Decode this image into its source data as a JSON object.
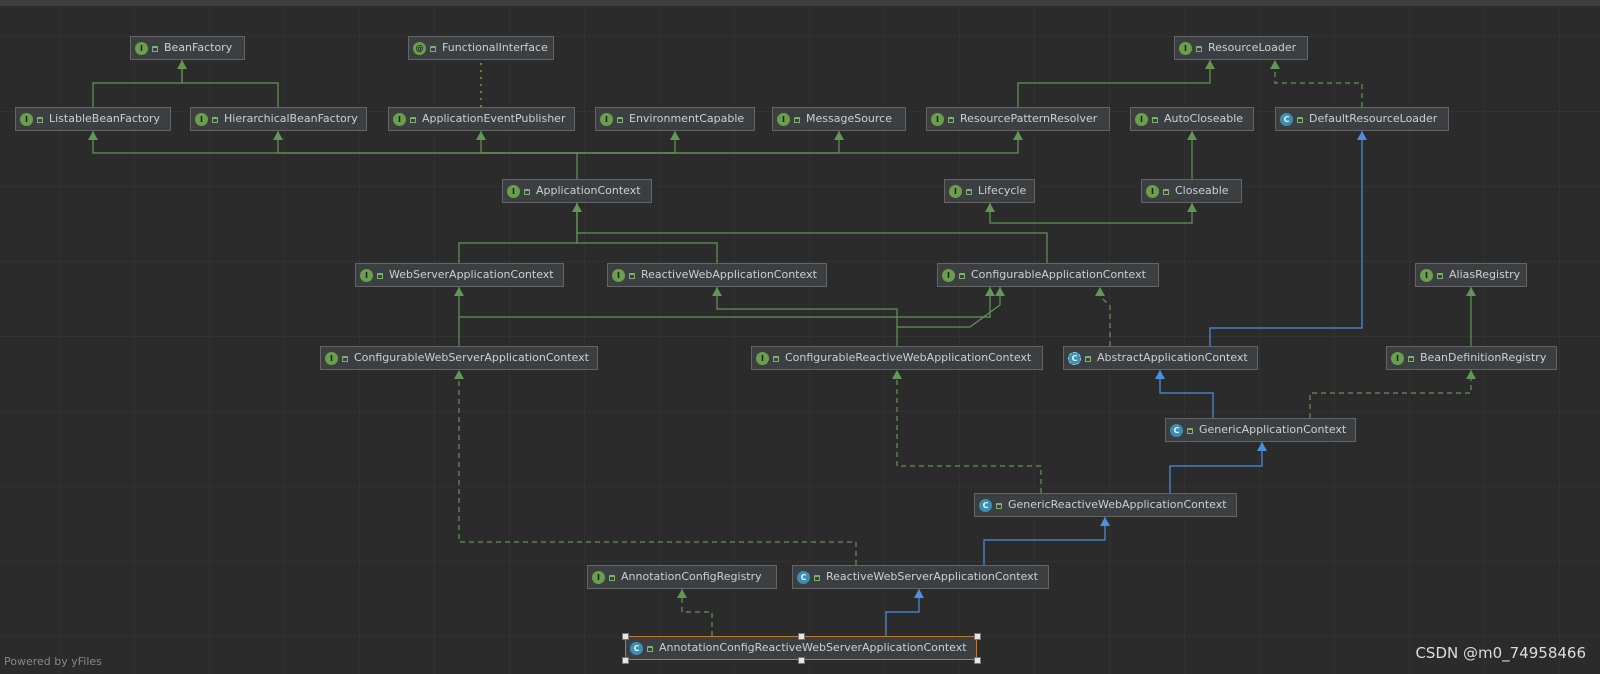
{
  "window": {
    "title": ""
  },
  "nodes": [
    {
      "id": "BeanFactory",
      "label": "BeanFactory",
      "kind": "interface"
    },
    {
      "id": "FunctionalInterface",
      "label": "FunctionalInterface",
      "kind": "annotation"
    },
    {
      "id": "ResourceLoader",
      "label": "ResourceLoader",
      "kind": "interface"
    },
    {
      "id": "ListableBeanFactory",
      "label": "ListableBeanFactory",
      "kind": "interface"
    },
    {
      "id": "HierarchicalBeanFactory",
      "label": "HierarchicalBeanFactory",
      "kind": "interface"
    },
    {
      "id": "ApplicationEventPublisher",
      "label": "ApplicationEventPublisher",
      "kind": "interface"
    },
    {
      "id": "EnvironmentCapable",
      "label": "EnvironmentCapable",
      "kind": "interface"
    },
    {
      "id": "MessageSource",
      "label": "MessageSource",
      "kind": "interface"
    },
    {
      "id": "ResourcePatternResolver",
      "label": "ResourcePatternResolver",
      "kind": "interface"
    },
    {
      "id": "AutoCloseable",
      "label": "AutoCloseable",
      "kind": "interface"
    },
    {
      "id": "DefaultResourceLoader",
      "label": "DefaultResourceLoader",
      "kind": "class"
    },
    {
      "id": "ApplicationContext",
      "label": "ApplicationContext",
      "kind": "interface"
    },
    {
      "id": "Lifecycle",
      "label": "Lifecycle",
      "kind": "interface"
    },
    {
      "id": "Closeable",
      "label": "Closeable",
      "kind": "interface"
    },
    {
      "id": "WebServerApplicationContext",
      "label": "WebServerApplicationContext",
      "kind": "interface"
    },
    {
      "id": "ReactiveWebApplicationContext",
      "label": "ReactiveWebApplicationContext",
      "kind": "interface"
    },
    {
      "id": "ConfigurableApplicationContext",
      "label": "ConfigurableApplicationContext",
      "kind": "interface"
    },
    {
      "id": "AliasRegistry",
      "label": "AliasRegistry",
      "kind": "interface"
    },
    {
      "id": "ConfigurableWebServerApplicationContext",
      "label": "ConfigurableWebServerApplicationContext",
      "kind": "interface"
    },
    {
      "id": "ConfigurableReactiveWebApplicationContext",
      "label": "ConfigurableReactiveWebApplicationContext",
      "kind": "interface"
    },
    {
      "id": "AbstractApplicationContext",
      "label": "AbstractApplicationContext",
      "kind": "abstract"
    },
    {
      "id": "BeanDefinitionRegistry",
      "label": "BeanDefinitionRegistry",
      "kind": "interface"
    },
    {
      "id": "GenericApplicationContext",
      "label": "GenericApplicationContext",
      "kind": "class"
    },
    {
      "id": "GenericReactiveWebApplicationContext",
      "label": "GenericReactiveWebApplicationContext",
      "kind": "class"
    },
    {
      "id": "AnnotationConfigRegistry",
      "label": "AnnotationConfigRegistry",
      "kind": "interface"
    },
    {
      "id": "ReactiveWebServerApplicationContext",
      "label": "ReactiveWebServerApplicationContext",
      "kind": "class"
    },
    {
      "id": "AnnotationConfigReactiveWebServerApplicationContext",
      "label": "AnnotationConfigReactiveWebServerApplicationContext",
      "kind": "class",
      "selected": true
    }
  ],
  "edges": [
    {
      "from": "ListableBeanFactory",
      "to": "BeanFactory",
      "type": "extends"
    },
    {
      "from": "HierarchicalBeanFactory",
      "to": "BeanFactory",
      "type": "extends"
    },
    {
      "from": "ApplicationEventPublisher",
      "to": "FunctionalInterface",
      "type": "annotated"
    },
    {
      "from": "ResourcePatternResolver",
      "to": "ResourceLoader",
      "type": "extends"
    },
    {
      "from": "DefaultResourceLoader",
      "to": "ResourceLoader",
      "type": "implements"
    },
    {
      "from": "ApplicationContext",
      "to": "ListableBeanFactory",
      "type": "extends"
    },
    {
      "from": "ApplicationContext",
      "to": "HierarchicalBeanFactory",
      "type": "extends"
    },
    {
      "from": "ApplicationContext",
      "to": "ApplicationEventPublisher",
      "type": "extends"
    },
    {
      "from": "ApplicationContext",
      "to": "EnvironmentCapable",
      "type": "extends"
    },
    {
      "from": "ApplicationContext",
      "to": "MessageSource",
      "type": "extends"
    },
    {
      "from": "ApplicationContext",
      "to": "ResourcePatternResolver",
      "type": "extends"
    },
    {
      "from": "Closeable",
      "to": "AutoCloseable",
      "type": "extends"
    },
    {
      "from": "WebServerApplicationContext",
      "to": "ApplicationContext",
      "type": "extends"
    },
    {
      "from": "ReactiveWebApplicationContext",
      "to": "ApplicationContext",
      "type": "extends"
    },
    {
      "from": "ConfigurableApplicationContext",
      "to": "ApplicationContext",
      "type": "extends"
    },
    {
      "from": "ConfigurableApplicationContext",
      "to": "Lifecycle",
      "type": "extends"
    },
    {
      "from": "ConfigurableApplicationContext",
      "to": "Closeable",
      "type": "extends"
    },
    {
      "from": "ConfigurableWebServerApplicationContext",
      "to": "WebServerApplicationContext",
      "type": "extends"
    },
    {
      "from": "ConfigurableWebServerApplicationContext",
      "to": "ConfigurableApplicationContext",
      "type": "extends"
    },
    {
      "from": "ConfigurableReactiveWebApplicationContext",
      "to": "ReactiveWebApplicationContext",
      "type": "extends"
    },
    {
      "from": "ConfigurableReactiveWebApplicationContext",
      "to": "ConfigurableApplicationContext",
      "type": "extends"
    },
    {
      "from": "AbstractApplicationContext",
      "to": "ConfigurableApplicationContext",
      "type": "implements"
    },
    {
      "from": "AbstractApplicationContext",
      "to": "DefaultResourceLoader",
      "type": "extends-class"
    },
    {
      "from": "BeanDefinitionRegistry",
      "to": "AliasRegistry",
      "type": "extends"
    },
    {
      "from": "GenericApplicationContext",
      "to": "AbstractApplicationContext",
      "type": "extends-class"
    },
    {
      "from": "GenericApplicationContext",
      "to": "BeanDefinitionRegistry",
      "type": "implements"
    },
    {
      "from": "GenericReactiveWebApplicationContext",
      "to": "GenericApplicationContext",
      "type": "extends-class"
    },
    {
      "from": "GenericReactiveWebApplicationContext",
      "to": "ConfigurableReactiveWebApplicationContext",
      "type": "implements"
    },
    {
      "from": "ReactiveWebServerApplicationContext",
      "to": "GenericReactiveWebApplicationContext",
      "type": "extends-class"
    },
    {
      "from": "ReactiveWebServerApplicationContext",
      "to": "ConfigurableWebServerApplicationContext",
      "type": "implements"
    },
    {
      "from": "AnnotationConfigReactiveWebServerApplicationContext",
      "to": "ReactiveWebServerApplicationContext",
      "type": "extends-class"
    },
    {
      "from": "AnnotationConfigReactiveWebServerApplicationContext",
      "to": "AnnotationConfigRegistry",
      "type": "implements"
    }
  ],
  "colors": {
    "interface_edge": "#629755",
    "class_edge": "#4d8fe2",
    "annotation_edge": "#a6b33a",
    "selection": "#c07a26"
  },
  "footer": {
    "powered_by": "Powered by yFiles",
    "watermark": "CSDN @m0_74958466"
  }
}
